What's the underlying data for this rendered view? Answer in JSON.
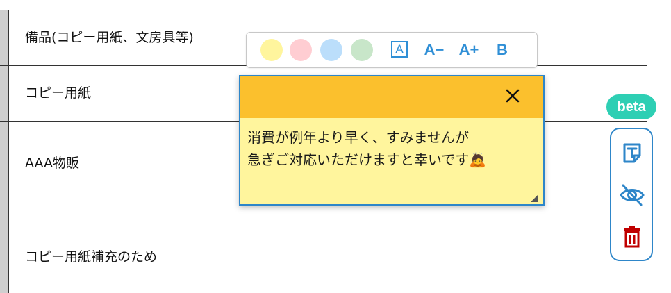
{
  "table": {
    "rows": [
      {
        "label": "備品(コピー用紙、文房具等)"
      },
      {
        "label": "コピー用紙"
      },
      {
        "label": "AAA物販"
      },
      {
        "label": "コピー用紙補充のため"
      }
    ]
  },
  "toolbar": {
    "swatches": [
      {
        "name": "yellow",
        "color": "#fff59d"
      },
      {
        "name": "pink",
        "color": "#ffcdd2"
      },
      {
        "name": "blue",
        "color": "#bbdefb"
      },
      {
        "name": "green",
        "color": "#c8e6c9"
      }
    ],
    "text_style_label": "A",
    "font_decrease_label": "A−",
    "font_increase_label": "A+",
    "bold_label": "B",
    "accent_color": "#2f8fd6"
  },
  "note": {
    "header_color": "#fbc02d",
    "body_color": "#fff59d",
    "border_color": "#2e86c9",
    "lines": [
      "消費が例年より早く、すみませんが",
      "急ぎご対応いただけますと幸いです🙇"
    ],
    "close_icon": "close-icon"
  },
  "side_panel": {
    "badge_label": "beta",
    "badge_color": "#2ecfb4",
    "buttons": [
      {
        "name": "add-note-icon",
        "color": "#2e86c9"
      },
      {
        "name": "hide-notes-icon",
        "color": "#2e86c9"
      },
      {
        "name": "delete-icon",
        "color": "#c00000"
      }
    ]
  }
}
